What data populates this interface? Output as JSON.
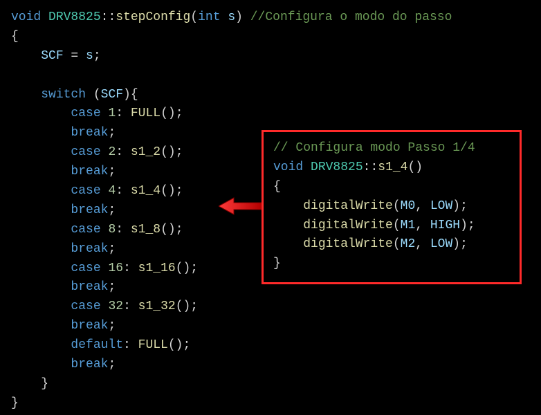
{
  "main": {
    "l1": {
      "kw_void": "void",
      "cls": "DRV8825",
      "scope": "::",
      "fn": "stepConfig",
      "lp": "(",
      "kw_int": "int",
      "param": "s",
      "rp": ")",
      "cmt": " //Configura o modo do passo"
    },
    "l2": "{",
    "l3": {
      "var": "SCF",
      "eq": " = ",
      "rhs": "s",
      "semi": ";"
    },
    "l4_switch": {
      "kw": "switch",
      "lp": " (",
      "var": "SCF",
      "rp": "){"
    },
    "cases": [
      {
        "kw": "case",
        "num": "1",
        "fn": "FULL",
        "brk": "break"
      },
      {
        "kw": "case",
        "num": "2",
        "fn": "s1_2",
        "brk": "break"
      },
      {
        "kw": "case",
        "num": "4",
        "fn": "s1_4",
        "brk": "break"
      },
      {
        "kw": "case",
        "num": "8",
        "fn": "s1_8",
        "brk": "break"
      },
      {
        "kw": "case",
        "num": "16",
        "fn": "s1_16",
        "brk": "break"
      },
      {
        "kw": "case",
        "num": "32",
        "fn": "s1_32",
        "brk": "break"
      }
    ],
    "default": {
      "kw": "default",
      "fn": "FULL",
      "brk": "break"
    },
    "close_switch": "}",
    "close_fn": "}"
  },
  "callout": {
    "cmt": "// Configura modo Passo 1/4",
    "sig": {
      "kw_void": "void",
      "cls": "DRV8825",
      "scope": "::",
      "fn": "s1_4",
      "lp": "(",
      "rp": ")"
    },
    "open": "{",
    "body": [
      {
        "fn": "digitalWrite",
        "arg0": "M0",
        "arg1": "LOW"
      },
      {
        "fn": "digitalWrite",
        "arg0": "M1",
        "arg1": "HIGH"
      },
      {
        "fn": "digitalWrite",
        "arg0": "M2",
        "arg1": "LOW"
      }
    ],
    "close": "}"
  }
}
